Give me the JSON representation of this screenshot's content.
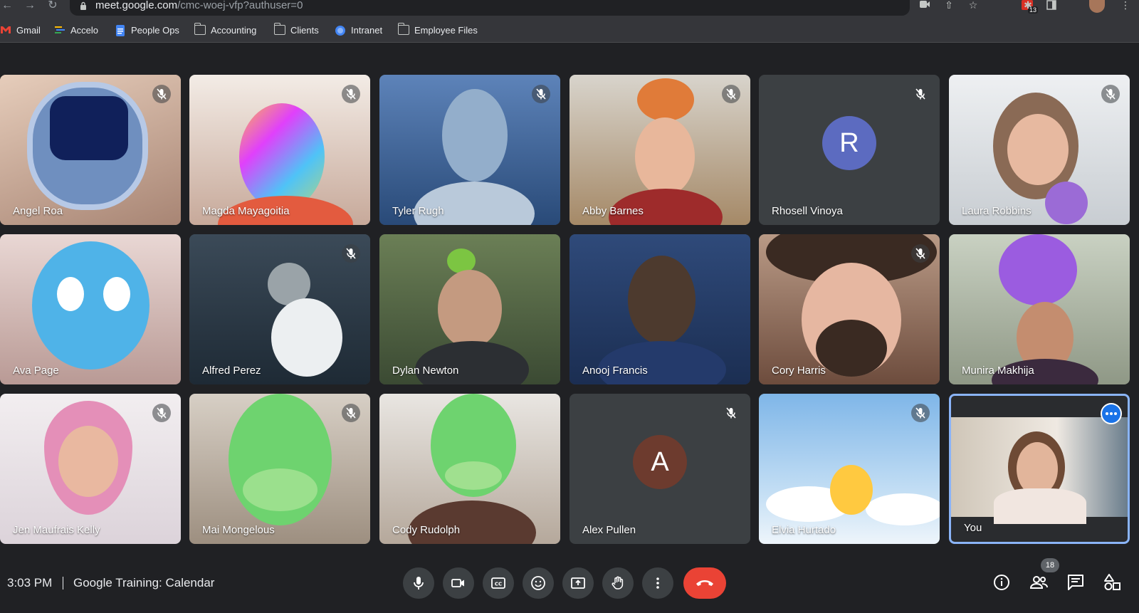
{
  "browser": {
    "url_host": "meet.google.com",
    "url_path": "/cmc-woej-vfp?authuser=0",
    "extension_badge": "13"
  },
  "bookmarks": [
    {
      "label": "Gmail",
      "icon": "gmail-icon"
    },
    {
      "label": "Accelo",
      "icon": "accelo-icon"
    },
    {
      "label": "People Ops",
      "icon": "docs-icon"
    },
    {
      "label": "Accounting",
      "icon": "folder-icon"
    },
    {
      "label": "Clients",
      "icon": "folder-icon"
    },
    {
      "label": "Intranet",
      "icon": "intranet-icon"
    },
    {
      "label": "Employee Files",
      "icon": "folder-icon"
    }
  ],
  "participants": [
    {
      "name": "Angel Roa",
      "muted": true
    },
    {
      "name": "Magda Mayagoitia",
      "muted": true
    },
    {
      "name": "Tyler Rugh",
      "muted": true
    },
    {
      "name": "Abby Barnes",
      "muted": true
    },
    {
      "name": "Rhosell Vinoya",
      "muted": true,
      "initial": "R",
      "color": "#5c6bc0"
    },
    {
      "name": "Laura Robbins",
      "muted": true
    },
    {
      "name": "Ava Page",
      "muted": false
    },
    {
      "name": "Alfred Perez",
      "muted": true
    },
    {
      "name": "Dylan Newton",
      "muted": false
    },
    {
      "name": "Anooj Francis",
      "muted": false
    },
    {
      "name": "Cory Harris",
      "muted": true
    },
    {
      "name": "Munira Makhija",
      "muted": false
    },
    {
      "name": "Jen Maufrais Kelly",
      "muted": true
    },
    {
      "name": "Mai Mongelous",
      "muted": true
    },
    {
      "name": "Cody Rudolph",
      "muted": false
    },
    {
      "name": "Alex Pullen",
      "muted": true,
      "initial": "A",
      "color": "#6d3b2e"
    },
    {
      "name": "Elvia Hurtado",
      "muted": true
    },
    {
      "name": "You",
      "muted": false
    }
  ],
  "bottom_bar": {
    "time": "3:03 PM",
    "meeting_title": "Google Training: Calendar",
    "people_count": "18"
  },
  "colors": {
    "background": "#202124",
    "tile": "#3c4043",
    "hangup": "#ea4335",
    "accent": "#1a73e8",
    "self_border": "#8ab4f8"
  }
}
